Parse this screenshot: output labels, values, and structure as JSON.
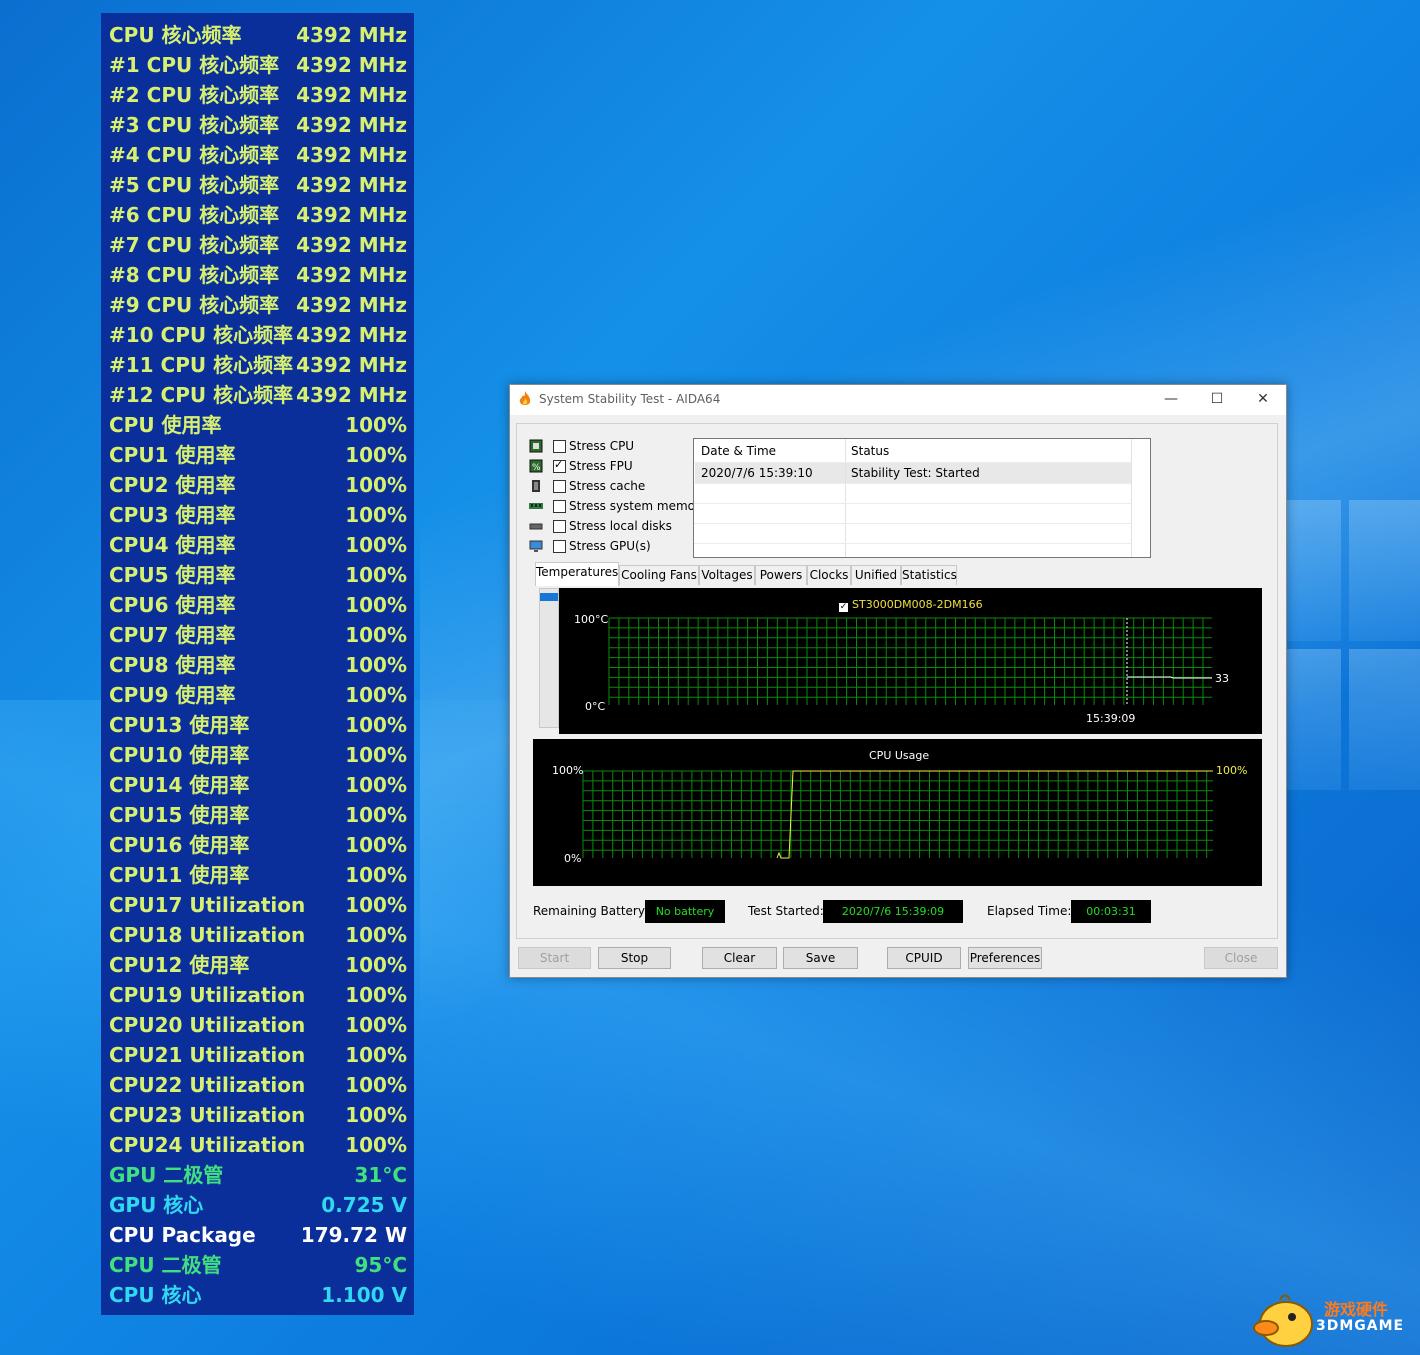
{
  "osd": {
    "rows": [
      {
        "label": "CPU 核心频率",
        "value": "4392 MHz",
        "color": "#d8f070"
      },
      {
        "label": "#1 CPU 核心频率",
        "value": "4392 MHz",
        "color": "#d8f070"
      },
      {
        "label": "#2 CPU 核心频率",
        "value": "4392 MHz",
        "color": "#d8f070"
      },
      {
        "label": "#3 CPU 核心频率",
        "value": "4392 MHz",
        "color": "#d8f070"
      },
      {
        "label": "#4 CPU 核心频率",
        "value": "4392 MHz",
        "color": "#d8f070"
      },
      {
        "label": "#5 CPU 核心频率",
        "value": "4392 MHz",
        "color": "#d8f070"
      },
      {
        "label": "#6 CPU 核心频率",
        "value": "4392 MHz",
        "color": "#d8f070"
      },
      {
        "label": "#7 CPU 核心频率",
        "value": "4392 MHz",
        "color": "#d8f070"
      },
      {
        "label": "#8 CPU 核心频率",
        "value": "4392 MHz",
        "color": "#d8f070"
      },
      {
        "label": "#9 CPU 核心频率",
        "value": "4392 MHz",
        "color": "#d8f070"
      },
      {
        "label": "#10 CPU 核心频率",
        "value": "4392 MHz",
        "color": "#d8f070"
      },
      {
        "label": "#11 CPU 核心频率",
        "value": "4392 MHz",
        "color": "#d8f070"
      },
      {
        "label": "#12 CPU 核心频率",
        "value": "4392 MHz",
        "color": "#d8f070"
      },
      {
        "label": "CPU 使用率",
        "value": "100%",
        "color": "#d8f070"
      },
      {
        "label": "CPU1 使用率",
        "value": "100%",
        "color": "#d8f070"
      },
      {
        "label": "CPU2 使用率",
        "value": "100%",
        "color": "#d8f070"
      },
      {
        "label": "CPU3 使用率",
        "value": "100%",
        "color": "#d8f070"
      },
      {
        "label": "CPU4 使用率",
        "value": "100%",
        "color": "#d8f070"
      },
      {
        "label": "CPU5 使用率",
        "value": "100%",
        "color": "#d8f070"
      },
      {
        "label": "CPU6 使用率",
        "value": "100%",
        "color": "#d8f070"
      },
      {
        "label": "CPU7 使用率",
        "value": "100%",
        "color": "#d8f070"
      },
      {
        "label": "CPU8 使用率",
        "value": "100%",
        "color": "#d8f070"
      },
      {
        "label": "CPU9 使用率",
        "value": "100%",
        "color": "#d8f070"
      },
      {
        "label": "CPU13 使用率",
        "value": "100%",
        "color": "#d8f070"
      },
      {
        "label": "CPU10 使用率",
        "value": "100%",
        "color": "#d8f070"
      },
      {
        "label": "CPU14 使用率",
        "value": "100%",
        "color": "#d8f070"
      },
      {
        "label": "CPU15 使用率",
        "value": "100%",
        "color": "#d8f070"
      },
      {
        "label": "CPU16 使用率",
        "value": "100%",
        "color": "#d8f070"
      },
      {
        "label": "CPU11 使用率",
        "value": "100%",
        "color": "#d8f070"
      },
      {
        "label": "CPU17 Utilization",
        "value": "100%",
        "color": "#d8f070"
      },
      {
        "label": "CPU18 Utilization",
        "value": "100%",
        "color": "#d8f070"
      },
      {
        "label": "CPU12 使用率",
        "value": "100%",
        "color": "#d8f070"
      },
      {
        "label": "CPU19 Utilization",
        "value": "100%",
        "color": "#d8f070"
      },
      {
        "label": "CPU20 Utilization",
        "value": "100%",
        "color": "#d8f070"
      },
      {
        "label": "CPU21 Utilization",
        "value": "100%",
        "color": "#d8f070"
      },
      {
        "label": "CPU22 Utilization",
        "value": "100%",
        "color": "#d8f070"
      },
      {
        "label": "CPU23 Utilization",
        "value": "100%",
        "color": "#d8f070"
      },
      {
        "label": "CPU24 Utilization",
        "value": "100%",
        "color": "#d8f070"
      },
      {
        "label": "GPU 二极管",
        "value": "31°C",
        "color": "#40e080"
      },
      {
        "label": "GPU 核心",
        "value": "0.725 V",
        "color": "#30d8f0"
      },
      {
        "label": "CPU Package",
        "value": "179.72 W",
        "color": "#ffffff"
      },
      {
        "label": "CPU 二极管",
        "value": "95°C",
        "color": "#40e080"
      },
      {
        "label": "CPU 核心",
        "value": "1.100 V",
        "color": "#30d8f0"
      }
    ]
  },
  "window": {
    "title": "System Stability Test - AIDA64",
    "controls": {
      "minimize": "—",
      "maximize": "☐",
      "close": "✕"
    },
    "stress": [
      {
        "label": "Stress CPU",
        "checked": false,
        "icon": "cpu-chip-icon"
      },
      {
        "label": "Stress FPU",
        "checked": true,
        "icon": "fpu-chip-icon"
      },
      {
        "label": "Stress cache",
        "checked": false,
        "icon": "cache-icon"
      },
      {
        "label": "Stress system memory",
        "checked": false,
        "icon": "memory-module-icon"
      },
      {
        "label": "Stress local disks",
        "checked": false,
        "icon": "disk-drive-icon"
      },
      {
        "label": "Stress GPU(s)",
        "checked": false,
        "icon": "monitor-icon"
      }
    ],
    "log": {
      "headers": [
        "Date & Time",
        "Status"
      ],
      "rows": [
        [
          "2020/7/6 15:39:10",
          "Stability Test: Started"
        ]
      ]
    },
    "tabs": [
      "Temperatures",
      "Cooling Fans",
      "Voltages",
      "Powers",
      "Clocks",
      "Unified",
      "Statistics"
    ],
    "temp_graph": {
      "legend": "ST3000DM008-2DM166",
      "y_max_label": "100°C",
      "y_min_label": "0°C",
      "time_label": "15:39:09",
      "current_value": "33",
      "line_color": "#ffffff"
    },
    "cpu_graph": {
      "title": "CPU Usage",
      "y_max_label": "100%",
      "y_min_label": "0%",
      "current_value": "100%",
      "line_color": "#f0f040"
    },
    "status": {
      "battery_label": "Remaining Battery:",
      "battery_value": "No battery",
      "started_label": "Test Started:",
      "started_value": "2020/7/6 15:39:09",
      "elapsed_label": "Elapsed Time:",
      "elapsed_value": "00:03:31"
    },
    "buttons": {
      "start": "Start",
      "stop": "Stop",
      "clear": "Clear",
      "save": "Save",
      "cpuid": "CPUID",
      "preferences": "Preferences",
      "close": "Close"
    }
  },
  "watermark": {
    "cn": "游戏硬件",
    "en": "3DMGAME"
  }
}
